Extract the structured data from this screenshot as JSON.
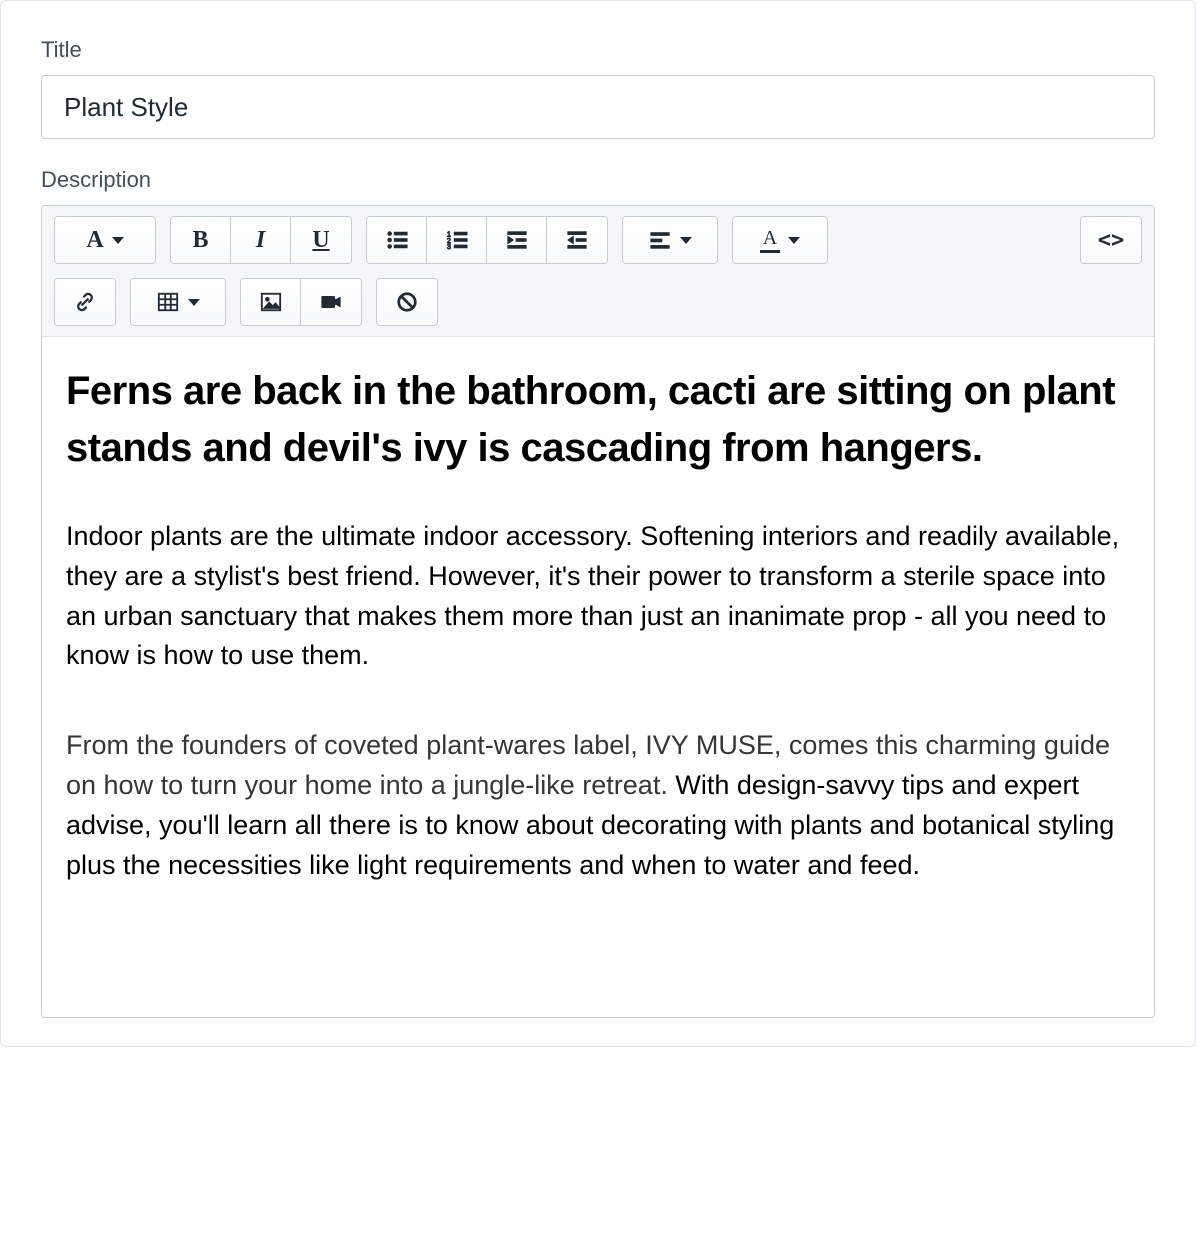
{
  "labels": {
    "title": "Title",
    "description": "Description"
  },
  "title_value": "Plant Style",
  "toolbar": {
    "font_style_glyph": "A",
    "bold_glyph": "B",
    "italic_glyph": "I",
    "underline_glyph": "U",
    "font_color_glyph": "A",
    "code_glyph": "<>"
  },
  "content": {
    "heading": "Ferns are back in the bathroom, cacti are sitting on plant stands and devil's ivy is cascading from hangers.",
    "para1": "Indoor plants are the ultimate indoor accessory. Softening interiors and readily available, they are a stylist's best friend. However, it's their power to transform a sterile space into an urban sanctuary that makes them more than just an inanimate prop - all you need to know is how to use them.",
    "para2_lead": "From the founders of coveted plant-wares label, IVY MUSE, comes this charming guide on how to turn your home into a jungle-like retreat. ",
    "para2_rest": "With design-savvy tips and expert advise, you'll learn all there is to know about decorating with plants and botanical styling plus the necessities like light requirements and when to water and feed."
  }
}
